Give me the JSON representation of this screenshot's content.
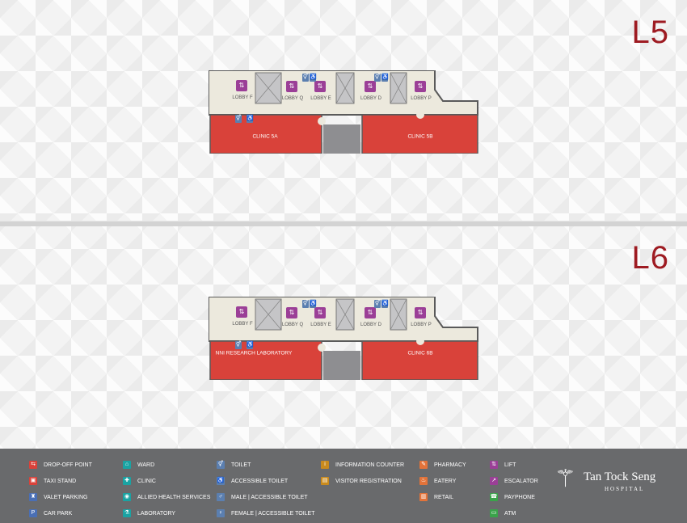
{
  "colors": {
    "clinic": "#d9423a",
    "corridor": "#ece9dd",
    "lift_shaft": "#c5c5c7",
    "lobby_icon": "#9b3f97",
    "toilet_icon": "#5b7fb0",
    "level_text": "#9e1b22",
    "legend_bg": "#696a6c"
  },
  "levels": [
    {
      "label": "L5",
      "lobbies": [
        "LOBBY F",
        "LOBBY Q",
        "LOBBY E",
        "LOBBY D",
        "LOBBY P"
      ],
      "rooms": [
        "CLINIC 5A",
        "CLINIC 5B"
      ]
    },
    {
      "label": "L6",
      "lobbies": [
        "LOBBY F",
        "LOBBY Q",
        "LOBBY E",
        "LOBBY D",
        "LOBBY P"
      ],
      "rooms": [
        "NNI RESEARCH LABORATORY",
        "CLINIC 6B"
      ]
    }
  ],
  "legend": [
    [
      {
        "label": "DROP-OFF POINT",
        "icon": "car-dropoff-icon",
        "color": "#d9423a",
        "glyph": "⇆"
      },
      {
        "label": "TAXI STAND",
        "icon": "taxi-icon",
        "color": "#d9423a",
        "glyph": "▣"
      },
      {
        "label": "VALET PARKING",
        "icon": "valet-icon",
        "color": "#4a6fb5",
        "glyph": "♜"
      },
      {
        "label": "CAR PARK",
        "icon": "car-park-icon",
        "color": "#4a6fb5",
        "glyph": "P"
      }
    ],
    [
      {
        "label": "WARD",
        "icon": "ward-icon",
        "color": "#1aa3a3",
        "glyph": "⌂"
      },
      {
        "label": "CLINIC",
        "icon": "clinic-icon",
        "color": "#1aa3a3",
        "glyph": "✚"
      },
      {
        "label": "ALLIED HEALTH SERVICES",
        "icon": "allied-health-icon",
        "color": "#1aa3a3",
        "glyph": "◉"
      },
      {
        "label": "LABORATORY",
        "icon": "laboratory-icon",
        "color": "#1aa3a3",
        "glyph": "⚗"
      }
    ],
    [
      {
        "label": "TOILET",
        "icon": "toilet-icon",
        "color": "#5b7fb0",
        "glyph": "⚥"
      },
      {
        "label": "ACCESSIBLE TOILET",
        "icon": "accessible-toilet-icon",
        "color": "#5b7fb0",
        "glyph": "♿"
      },
      {
        "label": "MALE | ACCESSIBLE TOILET",
        "icon": "male-accessible-toilet-icon",
        "color": "#5b7fb0",
        "glyph": "♂"
      },
      {
        "label": "FEMALE | ACCESSIBLE TOILET",
        "icon": "female-accessible-toilet-icon",
        "color": "#5b7fb0",
        "glyph": "♀"
      }
    ],
    [
      {
        "label": "INFORMATION COUNTER",
        "icon": "information-icon",
        "color": "#c98a1d",
        "glyph": "i"
      },
      {
        "label": "VISITOR REGISTRATION",
        "icon": "visitor-registration-icon",
        "color": "#c98a1d",
        "glyph": "▤"
      }
    ],
    [
      {
        "label": "PHARMACY",
        "icon": "pharmacy-icon",
        "color": "#e2733a",
        "glyph": "✎"
      },
      {
        "label": "EATERY",
        "icon": "eatery-icon",
        "color": "#e2733a",
        "glyph": "♨"
      },
      {
        "label": "RETAIL",
        "icon": "retail-icon",
        "color": "#e2733a",
        "glyph": "▥"
      }
    ],
    [
      {
        "label": "LIFT",
        "icon": "lift-icon",
        "color": "#9b3f97",
        "glyph": "⇅"
      },
      {
        "label": "ESCALATOR",
        "icon": "escalator-icon",
        "color": "#9b3f97",
        "glyph": "↗"
      },
      {
        "label": "PAYPHONE",
        "icon": "payphone-icon",
        "color": "#3aa34a",
        "glyph": "☎"
      },
      {
        "label": "ATM",
        "icon": "atm-icon",
        "color": "#3aa34a",
        "glyph": "▭"
      }
    ]
  ],
  "brand": {
    "name": "Tan Tock Seng",
    "subtitle": "HOSPITAL"
  }
}
